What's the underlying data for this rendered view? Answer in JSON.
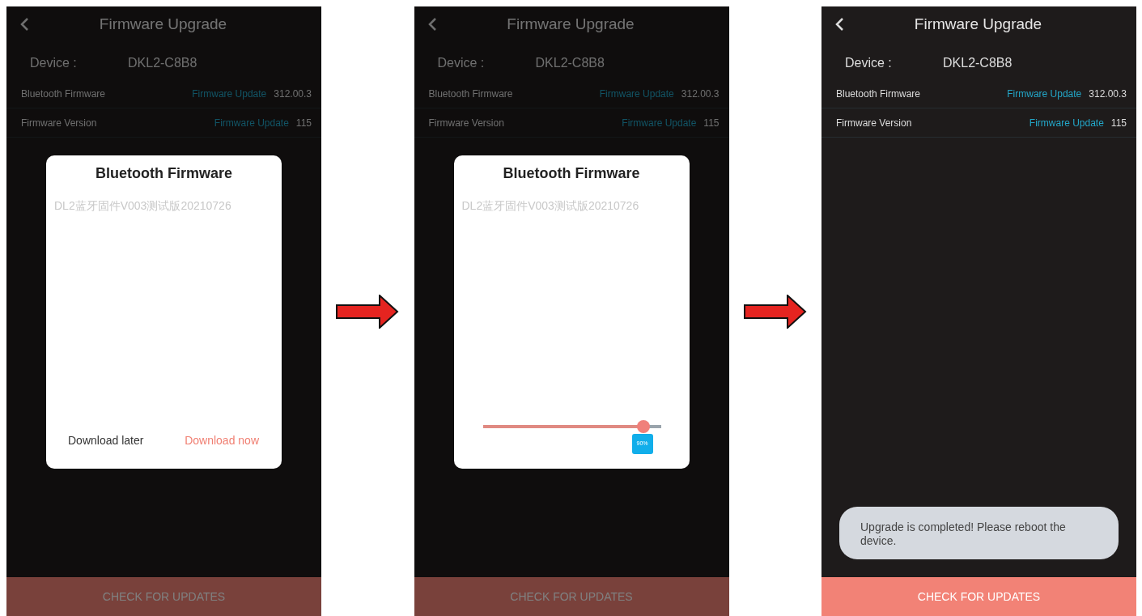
{
  "screens": [
    {
      "title": "Firmware Upgrade",
      "device_label": "Device :",
      "device_value": "DKL2-C8B8",
      "dimmed": true,
      "rows": [
        {
          "label": "Bluetooth Firmware",
          "link": "Firmware Update",
          "version": "312.00.3"
        },
        {
          "label": "Firmware Version",
          "link": "Firmware Update",
          "version": "115"
        }
      ],
      "dialog": {
        "kind": "download",
        "title": "Bluetooth Firmware",
        "description": "DL2蓝牙固件V003测试版20210726",
        "buttons": [
          "Download later",
          "Download now"
        ]
      },
      "button": "CHECK FOR UPDATES"
    },
    {
      "title": "Firmware Upgrade",
      "device_label": "Device :",
      "device_value": "DKL2-C8B8",
      "dimmed": true,
      "rows": [
        {
          "label": "Bluetooth Firmware",
          "link": "Firmware Update",
          "version": "312.00.3"
        },
        {
          "label": "Firmware Version",
          "link": "Firmware Update",
          "version": "115"
        }
      ],
      "dialog": {
        "kind": "progress",
        "title": "Bluetooth Firmware",
        "description": "DL2蓝牙固件V003测试版20210726",
        "level": 0.9,
        "reading": "90%"
      },
      "button": "CHECK FOR UPDATES"
    },
    {
      "title": "Firmware Upgrade",
      "device_label": "Device :",
      "device_value": "DKL2-C8B8",
      "dimmed": false,
      "rows": [
        {
          "label": "Bluetooth Firmware",
          "link": "Firmware Update",
          "version": "312.00.3"
        },
        {
          "label": "Firmware Version",
          "link": "Firmware Update",
          "version": "115"
        }
      ],
      "toast": "Upgrade is completed! Please reboot the device.",
      "button": "CHECK FOR UPDATES"
    }
  ]
}
